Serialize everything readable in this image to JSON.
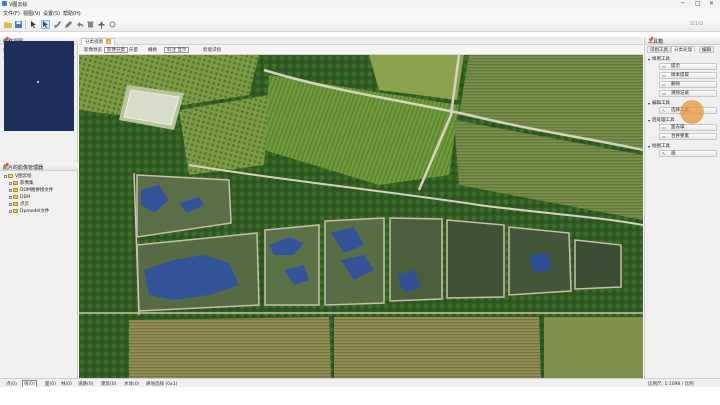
{
  "titlebar": {
    "title": "V图云绘",
    "controls": [
      "─",
      "□",
      "✕"
    ]
  },
  "menus": [
    "文件(F)",
    "视图(V)",
    "设置(S)",
    "帮助(H)"
  ],
  "toolbar": {
    "icons": [
      "folder-open-icon",
      "save-icon",
      "pointer-icon",
      "cursor-icon",
      "brush-icon",
      "draw-icon",
      "undo-icon",
      "delete-icon",
      "pin-icon",
      "measure-icon"
    ],
    "right_label": "ZC1V2"
  },
  "left_panel": {
    "overview_title": "缩略视图",
    "scale_label": "影像显示",
    "scale_value": "全部",
    "tree_title": "航片的影像管理器",
    "tree": [
      {
        "label": "V图云绘",
        "level": 0,
        "open": true
      },
      {
        "label": "影像集",
        "level": 1,
        "open": false
      },
      {
        "label": "DOM图拼接文件",
        "level": 1,
        "open": false
      },
      {
        "label": "DEM",
        "level": 1,
        "open": false
      },
      {
        "label": "点云",
        "level": 1,
        "open": false
      },
      {
        "label": "Dpmodel文件",
        "level": 1,
        "open": false
      }
    ]
  },
  "doc_tab": {
    "label": "分类视图",
    "close": "x"
  },
  "map_tools": [
    {
      "label": "影像预览",
      "selected": false
    },
    {
      "label": "影像分类",
      "selected": true
    },
    {
      "label": "矢量",
      "selected": false
    },
    {
      "label": "栅格",
      "selected": false
    },
    {
      "label": "标注 显示",
      "selected": true
    },
    {
      "label": "智能识别",
      "selected": false
    }
  ],
  "right_panel": {
    "title": "工具箱",
    "tabs": [
      {
        "label": "识别工具",
        "on": false
      },
      {
        "label": "分类处理",
        "on": true
      },
      {
        "label": "编辑",
        "on": false
      }
    ],
    "sections": [
      {
        "title": "样例工具",
        "buttons": [
          "提示",
          "样本提取",
          "删除",
          "清除记录"
        ]
      },
      {
        "title": "编辑工具",
        "buttons": [
          "选择工具"
        ]
      },
      {
        "title": "后处理工具",
        "buttons": [
          "面去噪",
          "合并要素"
        ]
      },
      {
        "title": "绘图工具",
        "buttons": [
          "画"
        ]
      }
    ]
  },
  "status_bar": [
    {
      "label": "点(0)",
      "selected": false
    },
    {
      "label": "线(0)",
      "selected": true
    },
    {
      "label": "面(0)",
      "selected": false
    },
    {
      "label": "林(0)",
      "selected": false
    },
    {
      "label": "道路(0)",
      "selected": false
    },
    {
      "label": "建筑(0)",
      "selected": false
    },
    {
      "label": "水体(0)",
      "selected": false
    },
    {
      "label": "耕地选择 (0x1)",
      "selected": false
    }
  ],
  "status_right": "比例尺: 1:1098 / 比例"
}
